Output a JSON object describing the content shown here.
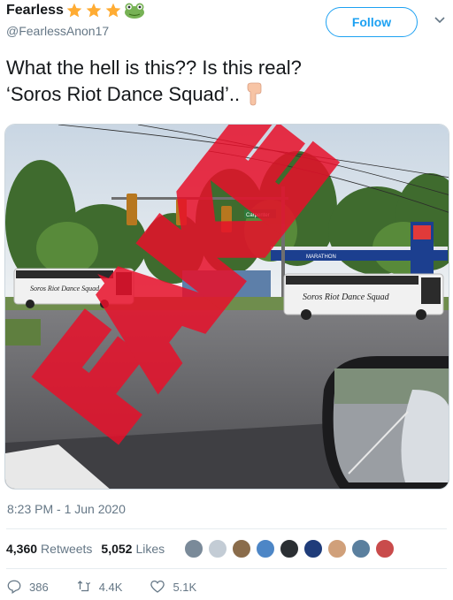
{
  "user": {
    "display_name": "Fearless",
    "handle": "@FearlessAnon17",
    "name_emojis": [
      "star-icon",
      "star-icon",
      "star-icon",
      "frog-icon"
    ]
  },
  "header": {
    "follow_label": "Follow"
  },
  "tweet": {
    "line1": "What the hell is this?? Is this real?",
    "line2": "‘Soros Riot Dance Squad’..",
    "emoji": "pointing-down-hand-icon"
  },
  "image": {
    "overlay_text": "FAKE",
    "bus_sign_left": "Soros Riot Dance Squad",
    "bus_sign_right": "Soros Riot Dance Squad",
    "street_sign": "Carpenter",
    "station_sign": "MARATHON"
  },
  "meta": {
    "timestamp": "8:23 PM - 1 Jun 2020"
  },
  "stats": {
    "retweets_count": "4,360",
    "retweets_label": "Retweets",
    "likes_count": "5,052",
    "likes_label": "Likes"
  },
  "actions": {
    "replies": "386",
    "retweets": "4.4K",
    "likes": "5.1K"
  },
  "colors": {
    "accent": "#1da1f2",
    "secondary_text": "#657786",
    "fake_red": "#e8102a"
  }
}
